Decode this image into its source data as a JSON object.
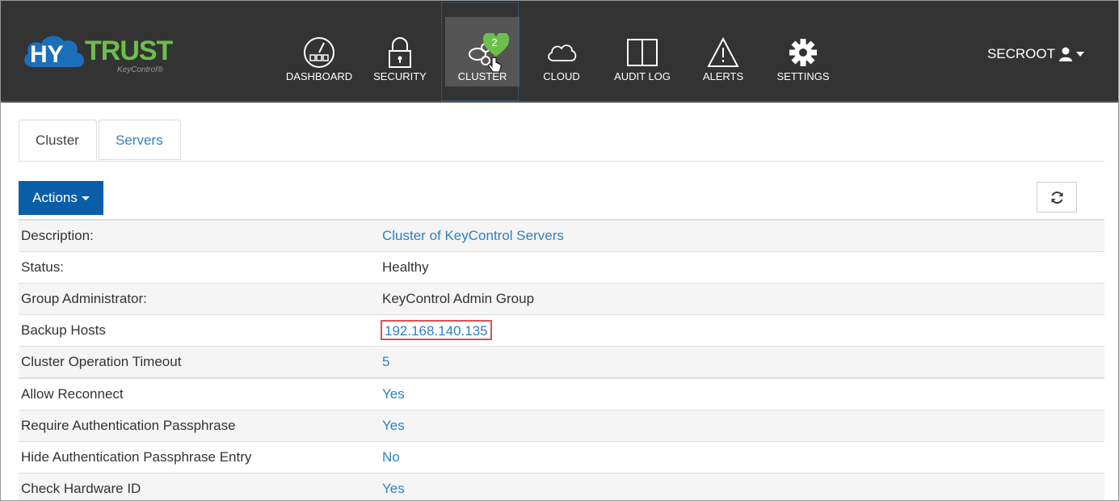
{
  "brand": {
    "logo_hy": "HY",
    "logo_trust": "TRUST",
    "logo_sub": "KeyControl®",
    "green": "#6dbf4b",
    "blue": "#1b6fb8"
  },
  "nav": {
    "items": [
      {
        "label": "DASHBOARD",
        "icon": "dashboard-gauge-icon"
      },
      {
        "label": "SECURITY",
        "icon": "padlock-icon"
      },
      {
        "label": "CLUSTER",
        "icon": "cluster-icon",
        "badge": "2",
        "active": true
      },
      {
        "label": "CLOUD",
        "icon": "cloud-icon"
      },
      {
        "label": "AUDIT LOG",
        "icon": "open-book-icon"
      },
      {
        "label": "ALERTS",
        "icon": "warning-triangle-icon"
      },
      {
        "label": "SETTINGS",
        "icon": "gear-icon"
      }
    ],
    "user": "SECROOT"
  },
  "tabs": [
    {
      "label": "Cluster",
      "active": true
    },
    {
      "label": "Servers",
      "active": false
    }
  ],
  "toolbar": {
    "actions_label": "Actions"
  },
  "properties": [
    {
      "key": "Description:",
      "value": "Cluster of KeyControl Servers",
      "link": true
    },
    {
      "key": "Status:",
      "value": "Healthy",
      "link": false
    },
    {
      "key": "Group Administrator:",
      "value": "KeyControl Admin Group",
      "link": false
    },
    {
      "key": "Backup Hosts",
      "value": "192.168.140.135",
      "link": true,
      "highlighted": true
    },
    {
      "key": "Cluster Operation Timeout",
      "value": "5",
      "link": true
    },
    {
      "key": "Allow Reconnect",
      "value": "Yes",
      "link": true
    },
    {
      "key": "Require Authentication Passphrase",
      "value": "Yes",
      "link": true
    },
    {
      "key": "Hide Authentication Passphrase Entry",
      "value": "No",
      "link": true
    },
    {
      "key": "Check Hardware ID",
      "value": "Yes",
      "link": true
    }
  ],
  "colors": {
    "navbar": "#333333",
    "link": "#2f80c0",
    "primary_button": "#0a5ea8",
    "highlight_border": "#d9534f"
  }
}
